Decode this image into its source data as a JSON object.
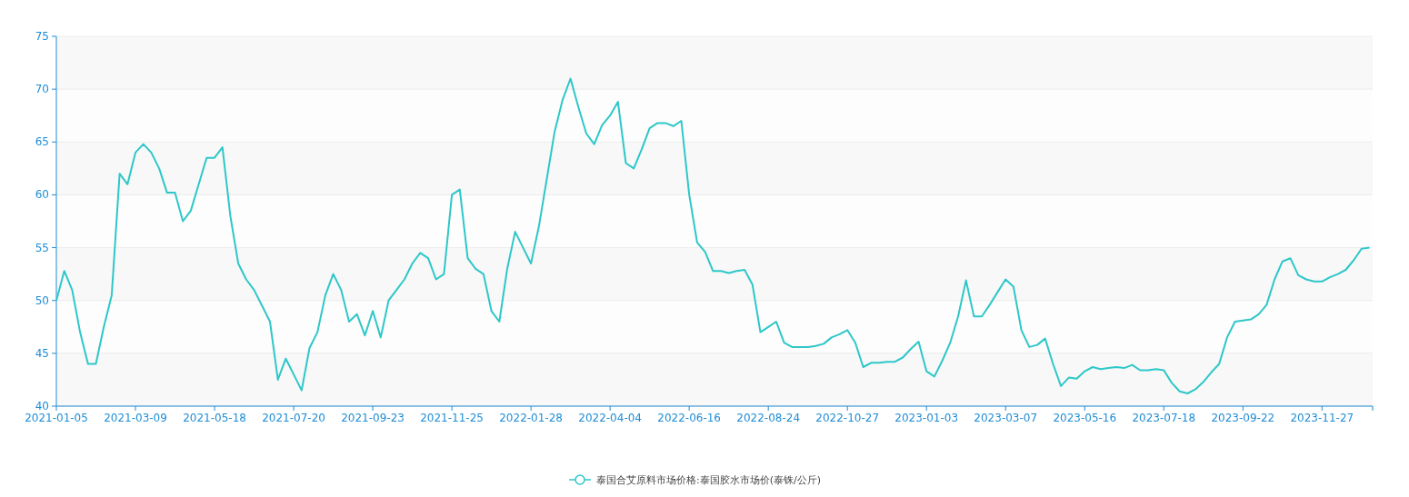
{
  "chart": {
    "chart_data": {
      "type": "line",
      "grid": true,
      "ylim": [
        40,
        75
      ],
      "yticks": [
        40,
        45,
        50,
        55,
        60,
        65,
        70,
        75
      ],
      "categories": [
        "2021-01-05",
        null,
        null,
        null,
        null,
        null,
        null,
        null,
        null,
        null,
        "2021-03-09",
        null,
        null,
        null,
        null,
        null,
        null,
        null,
        null,
        null,
        "2021-05-18",
        null,
        null,
        null,
        null,
        null,
        null,
        null,
        null,
        null,
        "2021-07-20",
        null,
        null,
        null,
        null,
        null,
        null,
        null,
        null,
        null,
        "2021-09-23",
        null,
        null,
        null,
        null,
        null,
        null,
        null,
        null,
        null,
        "2021-11-25",
        null,
        null,
        null,
        null,
        null,
        null,
        null,
        null,
        null,
        "2022-01-28",
        null,
        null,
        null,
        null,
        null,
        null,
        null,
        null,
        null,
        "2022-04-04",
        null,
        null,
        null,
        null,
        null,
        null,
        null,
        null,
        null,
        "2022-06-16",
        null,
        null,
        null,
        null,
        null,
        null,
        null,
        null,
        null,
        "2022-08-24",
        null,
        null,
        null,
        null,
        null,
        null,
        null,
        null,
        null,
        "2022-10-27",
        null,
        null,
        null,
        null,
        null,
        null,
        null,
        null,
        null,
        "2023-01-03",
        null,
        null,
        null,
        null,
        null,
        null,
        null,
        null,
        null,
        "2023-03-07",
        null,
        null,
        null,
        null,
        null,
        null,
        null,
        null,
        null,
        "2023-05-16",
        null,
        null,
        null,
        null,
        null,
        null,
        null,
        null,
        null,
        "2023-07-18",
        null,
        null,
        null,
        null,
        null,
        null,
        null,
        null,
        null,
        "2023-09-22",
        null,
        null,
        null,
        null,
        null,
        null,
        null,
        null,
        null,
        "2023-11-27",
        null,
        null,
        null,
        null,
        null,
        null
      ],
      "series": [
        {
          "name": "泰国合艾原料市场价格:泰国胶水市场价(泰铢/公斤)",
          "color": "#2ec7c9",
          "values": [
            50,
            52.8,
            51,
            47,
            44,
            44,
            47.5,
            50.5,
            62,
            61,
            64,
            64.8,
            64,
            62.5,
            60.2,
            60.2,
            57.5,
            58.5,
            61,
            63.5,
            63.5,
            64.5,
            58,
            53.5,
            52,
            51,
            49.5,
            48,
            42.5,
            44.5,
            43,
            41.5,
            45.5,
            47,
            50.5,
            52.5,
            51,
            48,
            48.7,
            46.7,
            49,
            46.5,
            50,
            51,
            52,
            53.5,
            54.5,
            54,
            52,
            52.5,
            60,
            60.5,
            54,
            53,
            52.5,
            49,
            48,
            53,
            56.5,
            55,
            53.5,
            57,
            61.5,
            66,
            69,
            71,
            68.3,
            65.8,
            64.8,
            66.6,
            67.5,
            68.8,
            63,
            62.5,
            64.3,
            66.3,
            66.8,
            66.8,
            66.5,
            67,
            60,
            55.5,
            54.6,
            52.8,
            52.8,
            52.6,
            52.8,
            52.9,
            51.5,
            47,
            47.5,
            48,
            46,
            45.6,
            45.6,
            45.6,
            45.7,
            45.9,
            46.5,
            46.8,
            47.2,
            46,
            43.7,
            44.1,
            44.1,
            44.2,
            44.2,
            44.6,
            45.4,
            46.1,
            43.3,
            42.8,
            44.3,
            46,
            48.5,
            51.9,
            48.5,
            48.5,
            49.6,
            50.8,
            52,
            51.3,
            47.2,
            45.6,
            45.8,
            46.4,
            44,
            41.9,
            42.7,
            42.6,
            43.3,
            43.7,
            43.5,
            43.6,
            43.7,
            43.6,
            43.9,
            43.4,
            43.4,
            43.5,
            43.4,
            42.2,
            41.4,
            41.2,
            41.6,
            42.3,
            43.2,
            44,
            46.5,
            48,
            48.1,
            48.2,
            48.7,
            49.6,
            52,
            53.7,
            54,
            52.4,
            52,
            51.8,
            51.8,
            52.2,
            52.5,
            52.9,
            53.8,
            54.9,
            55
          ]
        }
      ]
    }
  }
}
